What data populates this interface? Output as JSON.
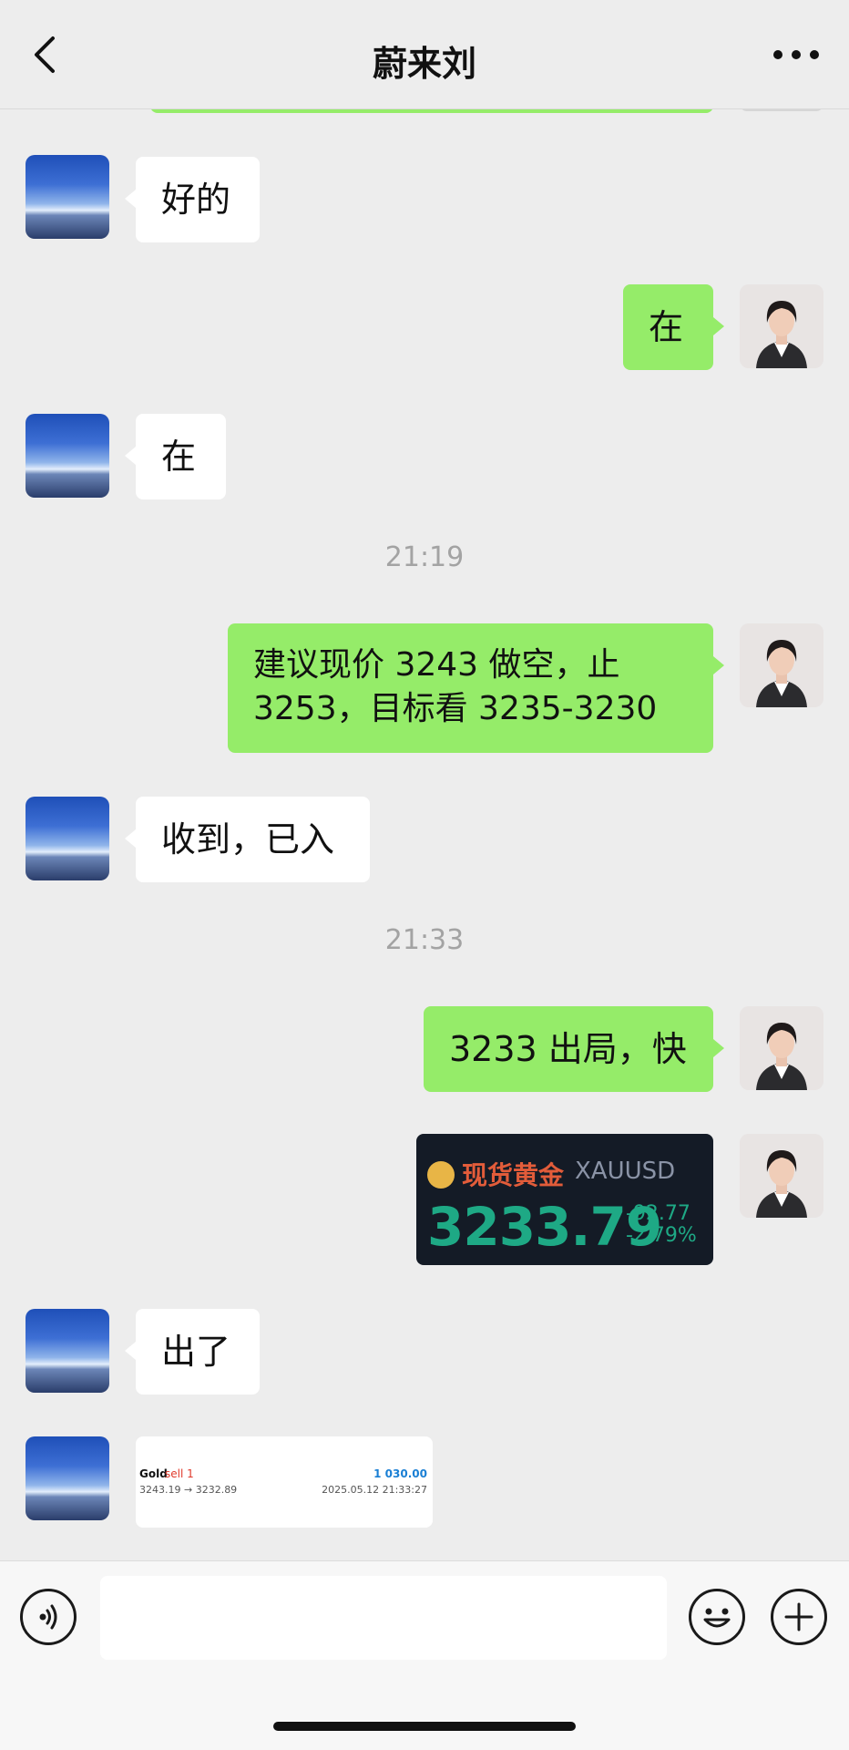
{
  "header": {
    "title": "蔚来刘"
  },
  "messages": {
    "m1": "好的",
    "m2": "在",
    "m3": "在",
    "time1": "21:19",
    "m4_line1": "建议现价 3243 做空，止",
    "m4_line2": "3253，目标看 3235-3230",
    "m5": "收到，已入",
    "time2": "21:33",
    "m6": "3233 出局，快",
    "m7": "出了"
  },
  "gold_card": {
    "name_cn": "现货黄金",
    "symbol": "XAUUSD",
    "price": "3233.79",
    "change": "-92.77",
    "change_pct": "-2.79%"
  },
  "trade_card": {
    "instrument": "Gold",
    "side": "sell 1",
    "prices": "3243.19 → 3232.89",
    "profit": "1 030.00",
    "datetime": "2025.05.12 21:33:27"
  },
  "input": {
    "placeholder": ""
  },
  "colors": {
    "bubble_right": "#95ec69",
    "bubble_left": "#ffffff",
    "background": "#ededed",
    "gold_price": "#1ea985",
    "gold_name": "#e25c3a"
  },
  "icons": {
    "back": "chevron-left-icon",
    "more": "more-icon",
    "voice": "voice-icon",
    "emoji": "emoji-icon",
    "plus": "plus-icon"
  }
}
